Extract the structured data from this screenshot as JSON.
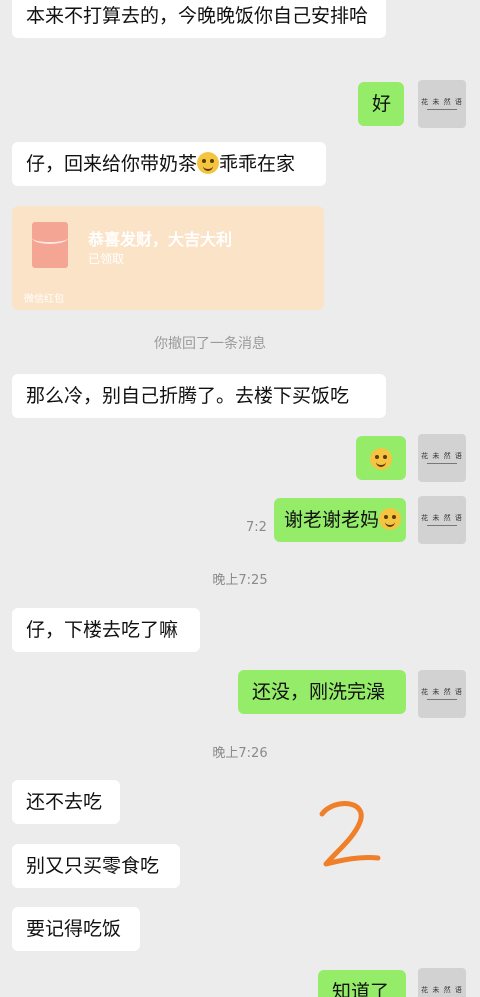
{
  "messages": {
    "m1": "本来不打算去的，今晚晚饭你自己安排哈",
    "m2": "好",
    "m3_a": "仔，回来给你带奶茶",
    "m3_b": "乖乖在家",
    "m5": "那么冷，别自己折腾了。去楼下买饭吃",
    "m7": "谢老谢老妈",
    "m8": "仔，下楼去吃了嘛",
    "m9": "还没，刚洗完澡",
    "m10": "还不去吃",
    "m11": "别又只买零食吃",
    "m12": "要记得吃饭",
    "m13": "知道了"
  },
  "red_packet": {
    "title": "恭喜发财，大吉大利",
    "status": "已领取",
    "footer": "微信红包"
  },
  "notice": "你撤回了一条消息",
  "times": {
    "t1": "晚上7:25",
    "t2": "晚上7:26",
    "overlap": "7:2"
  },
  "avatar": {
    "brand": "花 未 然 语"
  },
  "annotation": "2",
  "colors": {
    "background": "#ececec",
    "outgoing_bubble": "#95ec69",
    "incoming_bubble": "#ffffff",
    "red_packet": "#fbe3c8",
    "annotation_ink": "#f07f2a"
  },
  "icons": [
    "grin-emoji-icon",
    "wink-emoji-icon",
    "red-packet-icon",
    "avatar-image"
  ]
}
